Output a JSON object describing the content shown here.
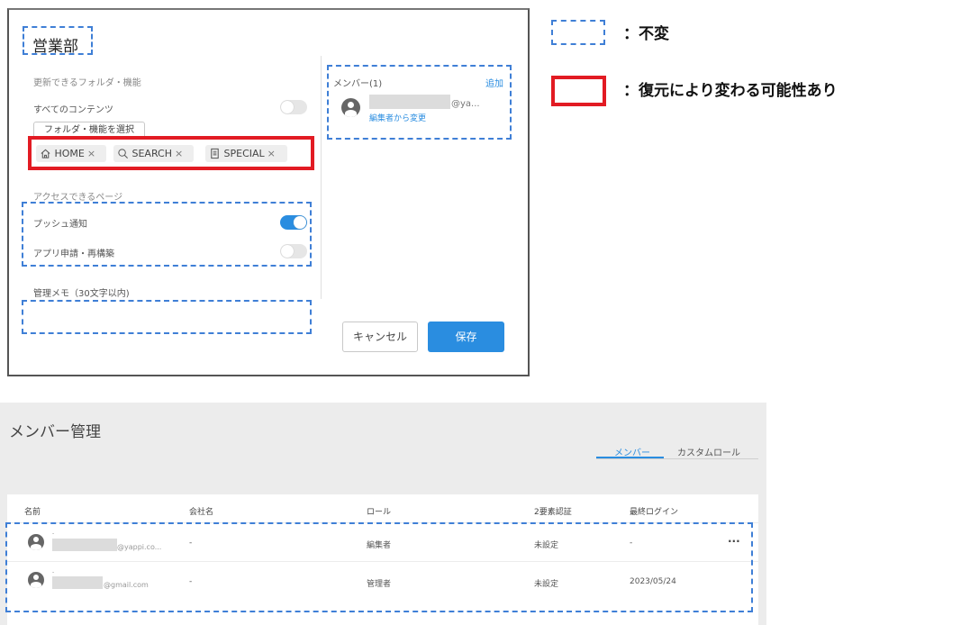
{
  "dialog": {
    "title": "営業部",
    "folders_label": "更新できるフォルダ・機能",
    "all_contents_label": "すべてのコンテンツ",
    "select_button": "フォルダ・機能を選択",
    "chips": [
      {
        "label": "HOME",
        "icon": "home-icon"
      },
      {
        "label": "SEARCH",
        "icon": "search-icon"
      },
      {
        "label": "SPECIAL",
        "icon": "document-icon"
      }
    ],
    "chip_remove": "×",
    "pages_label": "アクセスできるページ",
    "push_label": "プッシュ通知",
    "app_label": "アプリ申請・再構築",
    "memo_label": "管理メモ（30文字以内)",
    "members_label": "メンバー(1)",
    "add_link": "追加",
    "member_email": "@ya...",
    "change_link": "編集者から変更",
    "cancel_button": "キャンセル",
    "save_button": "保存",
    "toggles": {
      "all_contents": false,
      "push": true,
      "app": false
    }
  },
  "legend": {
    "unchanged": "：不変",
    "may_change": "：復元により変わる可能性あり"
  },
  "management": {
    "title": "メンバー管理",
    "tabs": [
      {
        "label": "メンバー",
        "active": true
      },
      {
        "label": "カスタムロール",
        "active": false
      }
    ],
    "columns": [
      "名前",
      "会社名",
      "ロール",
      "2要素認証",
      "最終ログイン"
    ],
    "rows": [
      {
        "name_top": "-",
        "email": "@yappi.co...",
        "company": "-",
        "role": "編集者",
        "two_factor": "未設定",
        "last_login": "-",
        "menu": "···"
      },
      {
        "name_top": "-",
        "email": "@gmail.com",
        "company": "-",
        "role": "管理者",
        "two_factor": "未設定",
        "last_login": "2023/05/24"
      }
    ]
  },
  "colors": {
    "accent": "#2a8de0",
    "dashed_legend": "#3f7fd6",
    "red_legend": "#e21b23"
  }
}
